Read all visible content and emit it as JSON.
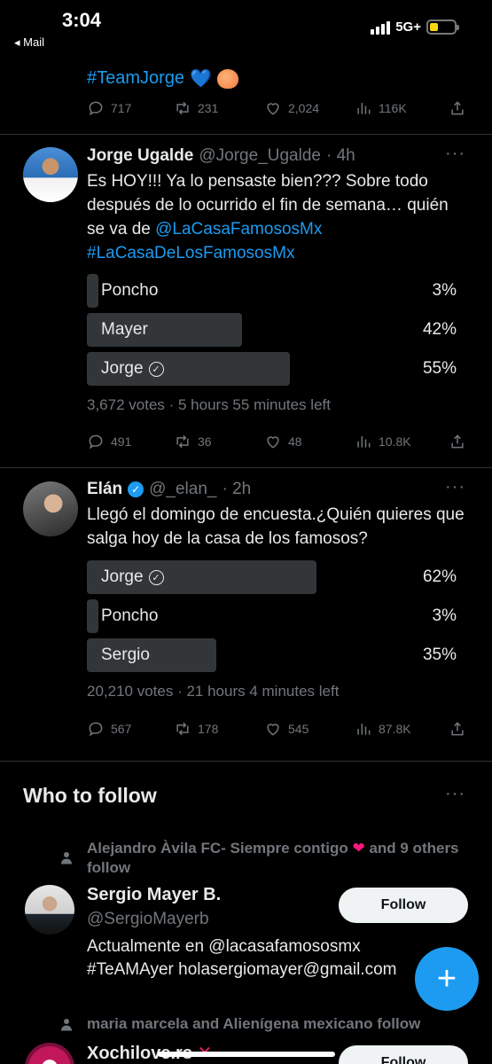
{
  "status": {
    "time": "3:04",
    "back_label": "◂ Mail",
    "network": "5G+"
  },
  "colors": {
    "accent": "#1d9bf0",
    "background": "#000000",
    "muted": "#71767b",
    "poll_bar": "#333639"
  },
  "tweet0": {
    "hashtag": "#TeamJorge",
    "emoji_heart": "💙",
    "stats": {
      "replies": "717",
      "retweets": "231",
      "likes": "2,024",
      "views": "116K"
    }
  },
  "tweet1": {
    "name": "Jorge Ugalde",
    "handle": "@Jorge_Ugalde",
    "time": "· 4h",
    "text": "Es HOY!!! Ya lo pensaste bien??? Sobre todo después de lo ocurrido el fin de semana… quién se va de ",
    "mention": "@LaCasaFamososMx",
    "hashtag": "#LaCasaDeLosFamososMx",
    "poll": [
      {
        "label": "Poncho",
        "pct": "3%",
        "fraction": 0.03,
        "winner": false
      },
      {
        "label": "Mayer",
        "pct": "42%",
        "fraction": 0.42,
        "winner": false
      },
      {
        "label": "Jorge",
        "pct": "55%",
        "fraction": 0.55,
        "winner": true
      }
    ],
    "meta": "3,672 votes · 5 hours 55 minutes left",
    "stats": {
      "replies": "491",
      "retweets": "36",
      "likes": "48",
      "views": "10.8K"
    }
  },
  "tweet2": {
    "name": "Elán",
    "handle": "@_elan_",
    "time": "· 2h",
    "text": "Llegó el domingo de encuesta.¿Quién quieres que salga hoy de la casa de los famosos?",
    "poll": [
      {
        "label": "Jorge",
        "pct": "62%",
        "fraction": 0.62,
        "winner": true
      },
      {
        "label": "Poncho",
        "pct": "3%",
        "fraction": 0.03,
        "winner": false
      },
      {
        "label": "Sergio",
        "pct": "35%",
        "fraction": 0.35,
        "winner": false
      }
    ],
    "meta": "20,210 votes · 21 hours 4 minutes left",
    "stats": {
      "replies": "567",
      "retweets": "178",
      "likes": "545",
      "views": "87.8K"
    }
  },
  "who_to_follow": {
    "title": "Who to follow",
    "suggestion1": {
      "context_prefix": "Alejandro Àvila FC- Siempre contigo",
      "context_suffix": "and 9 others follow",
      "name": "Sergio Mayer B.",
      "handle": "@SergioMayerb",
      "follow_label": "Follow",
      "bio_line1": "Actualmente en @lacasafamososmx",
      "bio_line2": "#TeAMAyer holasergiomayer@gmail.com"
    },
    "suggestion2": {
      "context": "maria marcela and Alienígena mexicano follow",
      "name": "Xochilove.rs",
      "follow_label": "Follow"
    }
  },
  "fab": {
    "label": "+"
  }
}
